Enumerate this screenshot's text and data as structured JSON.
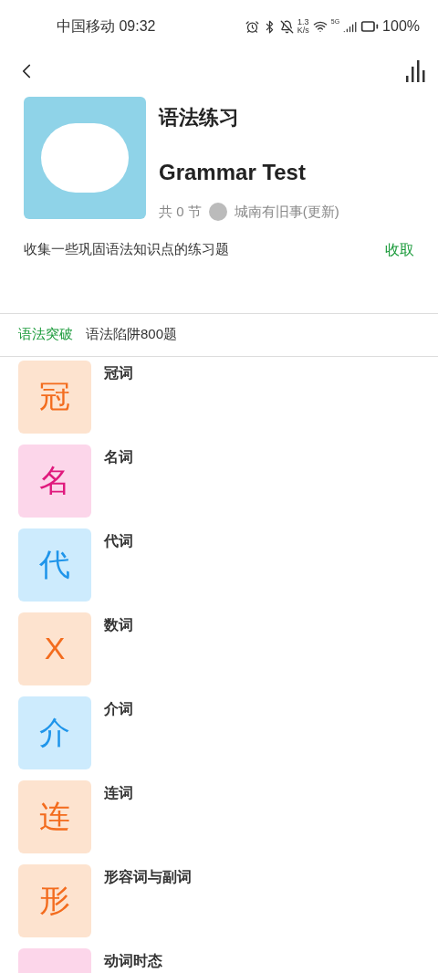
{
  "status_bar": {
    "carrier_time": "中国移动 09:32",
    "net_speed": "1.3",
    "net_unit": "K/s",
    "network": "5G",
    "battery": "100%"
  },
  "course": {
    "title": "语法练习",
    "subtitle": "Grammar Test",
    "count": "共 0 节",
    "author": "城南有旧事(更新)",
    "description": "收集一些巩固语法知识点的练习题",
    "collapse": "收取"
  },
  "tabs": [
    {
      "label": "语法突破",
      "selected": true
    },
    {
      "label": "语法陷阱800题",
      "selected": false
    }
  ],
  "lessons": [
    {
      "glyph": "冠",
      "title": "冠词",
      "color": "#fde3cf"
    },
    {
      "glyph": "名",
      "title": "名词",
      "color": "#fcd6ea"
    },
    {
      "glyph": "代",
      "title": "代词",
      "color": "#cdebfd"
    },
    {
      "glyph": "X",
      "title": "数词",
      "color": "#fde3cf"
    },
    {
      "glyph": "介",
      "title": "介词",
      "color": "#cdebfd"
    },
    {
      "glyph": "连",
      "title": "连词",
      "color": "#fde3cf"
    },
    {
      "glyph": "形",
      "title": "形容词与副词",
      "color": "#fde3cf"
    },
    {
      "title": "动词时态",
      "color": "#fcd6ea"
    }
  ]
}
